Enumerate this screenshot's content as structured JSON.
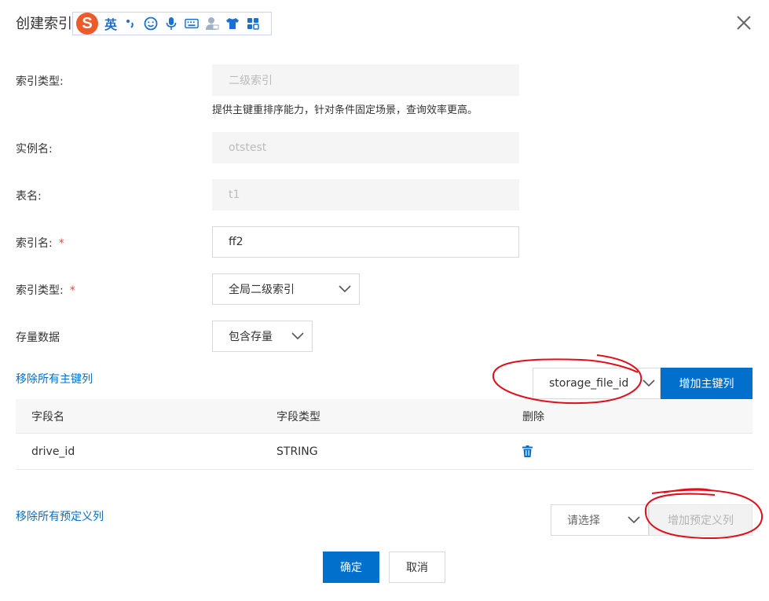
{
  "dialog": {
    "title": "创建索引"
  },
  "ime_toolbar": {
    "logo": "S",
    "language": "英",
    "icons": [
      "punctuation-icon",
      "emoji-icon",
      "microphone-icon",
      "keyboard-icon",
      "user-icon",
      "skin-icon",
      "apps-icon"
    ]
  },
  "form": {
    "index_category_label": "索引类型:",
    "index_category_value": "二级索引",
    "index_category_hint": "提供主键重排序能力，针对条件固定场景，查询效率更高。",
    "instance_label": "实例名:",
    "instance_value": "otstest",
    "table_label": "表名:",
    "table_value": "t1",
    "index_name_label": "索引名:",
    "index_name_value": "ff2",
    "index_type_label": "索引类型:",
    "index_type_value": "全局二级索引",
    "existing_data_label": "存量数据",
    "existing_data_value": "包含存量",
    "required_mark": "*"
  },
  "primary_keys": {
    "remove_all_link": "移除所有主键列",
    "select_value": "storage_file_id",
    "add_button": "增加主键列",
    "columns": [
      "字段名",
      "字段类型",
      "删除"
    ],
    "rows": [
      {
        "name": "drive_id",
        "type": "STRING"
      }
    ]
  },
  "predefined_columns": {
    "remove_all_link": "移除所有预定义列",
    "select_placeholder": "请选择",
    "add_button": "增加预定义列"
  },
  "footer": {
    "confirm": "确定",
    "cancel": "取消"
  },
  "colors": {
    "primary": "#0070cc",
    "annotation": "#e0101a"
  }
}
